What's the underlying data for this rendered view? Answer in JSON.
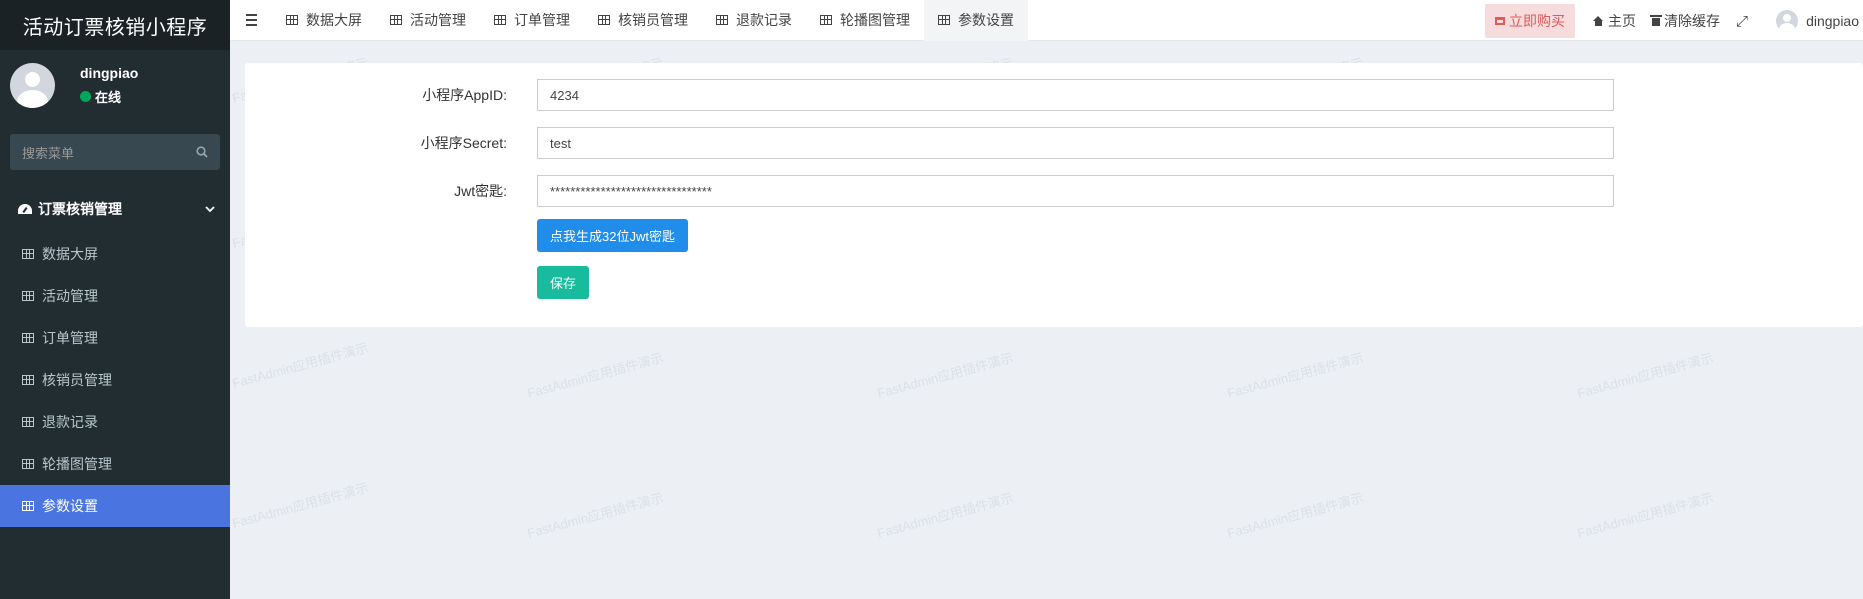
{
  "app": {
    "title": "活动订票核销小程序"
  },
  "user": {
    "name": "dingpiao",
    "status": "在线"
  },
  "sidebar": {
    "search_placeholder": "搜索菜单",
    "group": {
      "label": "订票核销管理"
    },
    "items": [
      {
        "label": "数据大屏",
        "icon": "table-icon"
      },
      {
        "label": "活动管理",
        "icon": "table-icon"
      },
      {
        "label": "订单管理",
        "icon": "table-icon"
      },
      {
        "label": "核销员管理",
        "icon": "table-icon"
      },
      {
        "label": "退款记录",
        "icon": "table-icon"
      },
      {
        "label": "轮播图管理",
        "icon": "table-icon"
      },
      {
        "label": "参数设置",
        "icon": "table-icon",
        "active": true
      }
    ]
  },
  "topbar": {
    "tabs": [
      {
        "label": "数据大屏"
      },
      {
        "label": "活动管理"
      },
      {
        "label": "订单管理"
      },
      {
        "label": "核销员管理"
      },
      {
        "label": "退款记录"
      },
      {
        "label": "轮播图管理"
      },
      {
        "label": "参数设置",
        "active": true
      }
    ],
    "buy_label": "立即购买",
    "home_label": "主页",
    "clear_cache_label": "清除缓存",
    "username": "dingpiao"
  },
  "form": {
    "appid": {
      "label": "小程序AppID:",
      "value": "4234"
    },
    "secret": {
      "label": "小程序Secret:",
      "value": "test"
    },
    "jwt": {
      "label": "Jwt密匙:",
      "value": "********************************"
    },
    "generate_button": "点我生成32位Jwt密匙",
    "save_button": "保存"
  },
  "watermark": {
    "text": "FastAdmin应用插件演示"
  },
  "colors": {
    "sidebar_bg": "#222d32",
    "active_menu": "#4a75e0",
    "primary": "#1f8de9",
    "success": "#18bc9c",
    "buy_bg": "#f6dcdc",
    "buy_text": "#e05a5a"
  }
}
